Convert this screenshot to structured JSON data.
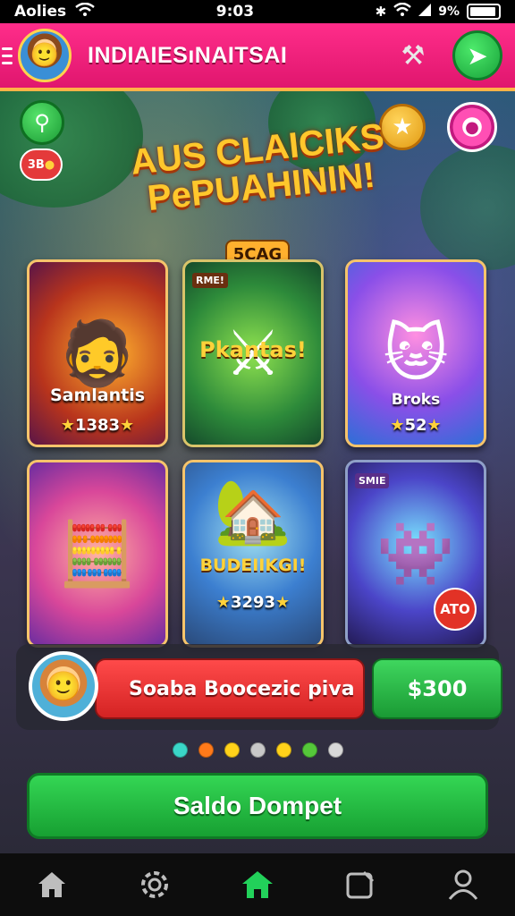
{
  "status_bar": {
    "carrier": "Aolies",
    "time": "9:03",
    "battery": "9%"
  },
  "header": {
    "title": "INDIAIESıNAITSAI"
  },
  "scene": {
    "coin_badge": "3B",
    "headline_line1": "AUS CLAICIKS",
    "headline_line2": "PePUAHININ!",
    "sub_badge": "5CAG"
  },
  "cards": [
    {
      "name": "Samlantis",
      "rating": "1383",
      "icon": "pirate-hero"
    },
    {
      "name": "Pkantas!",
      "tag": "RME!",
      "icon": "warrior-hero"
    },
    {
      "name": "Broks",
      "rating": "52",
      "icon": "cat-pilot"
    },
    {
      "name": "",
      "icon": "pirate-chest"
    },
    {
      "name": "BUDEIIKGI!",
      "rating": "3293",
      "icon": "treehouse"
    },
    {
      "name": "",
      "tag": "SMIE",
      "badge": "ATO",
      "icon": "robot-face"
    }
  ],
  "bonus": {
    "label": "Soaba Boocezic piva",
    "price": "$300"
  },
  "pager": {
    "dot_colors": [
      "#3ad6c8",
      "#ff7a1a",
      "#ffd21a",
      "#c8c8c8",
      "#ffd21a",
      "#55c83a",
      "#d8d8d8"
    ]
  },
  "primary_button": {
    "label": "Saldo Dompet"
  },
  "bottom_nav": [
    {
      "icon": "home-icon"
    },
    {
      "icon": "gear-icon"
    },
    {
      "icon": "home-active-icon"
    },
    {
      "icon": "note-icon"
    },
    {
      "icon": "user-icon"
    }
  ]
}
